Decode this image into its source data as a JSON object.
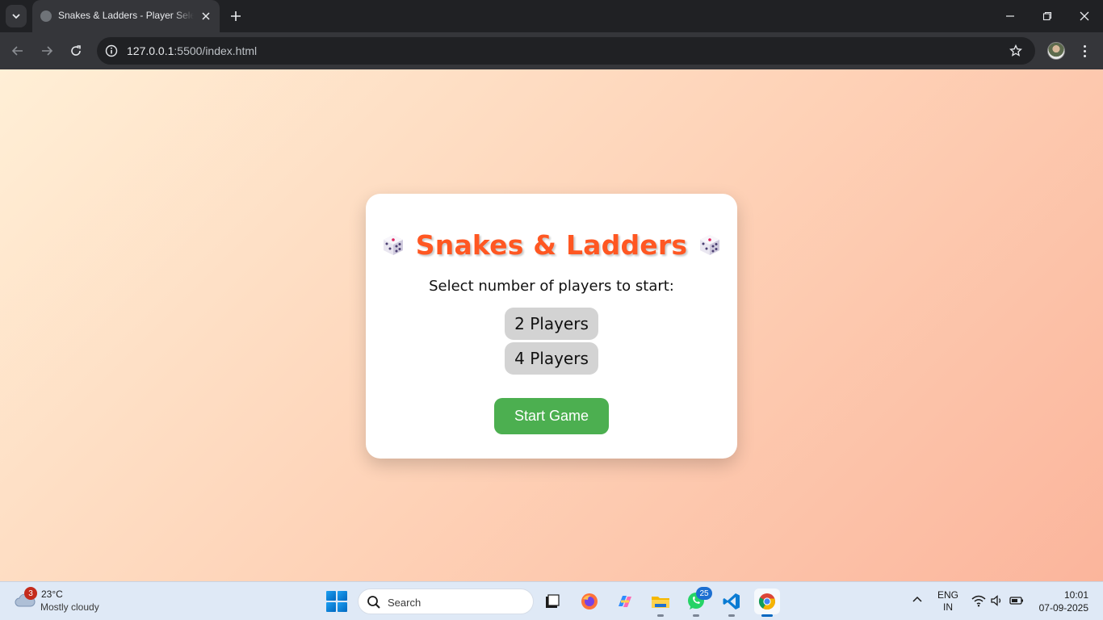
{
  "browser": {
    "tab_title": "Snakes & Ladders - Player Selection",
    "url_host": "127.0.0.1",
    "url_path": ":5500/index.html"
  },
  "page": {
    "title": "Snakes & Ladders",
    "subtitle": "Select number of players to start:",
    "player_options": [
      "2 Players",
      "4 Players"
    ],
    "start_label": "Start Game",
    "colors": {
      "title": "#ff5722",
      "start_button": "#4caf50",
      "player_button": "#d3d3d3",
      "background_start": "#ffefd6",
      "background_end": "#fbb59c"
    }
  },
  "taskbar": {
    "weather": {
      "temp": "23°C",
      "desc": "Mostly cloudy",
      "badge": "3"
    },
    "search_placeholder": "Search",
    "apps": [
      "task-view",
      "firefox",
      "copilot",
      "file-explorer",
      "whatsapp",
      "vscode",
      "chrome"
    ],
    "whatsapp_badge": "25",
    "lang_line1": "ENG",
    "lang_line2": "IN",
    "time": "10:01",
    "date": "07-09-2025"
  }
}
